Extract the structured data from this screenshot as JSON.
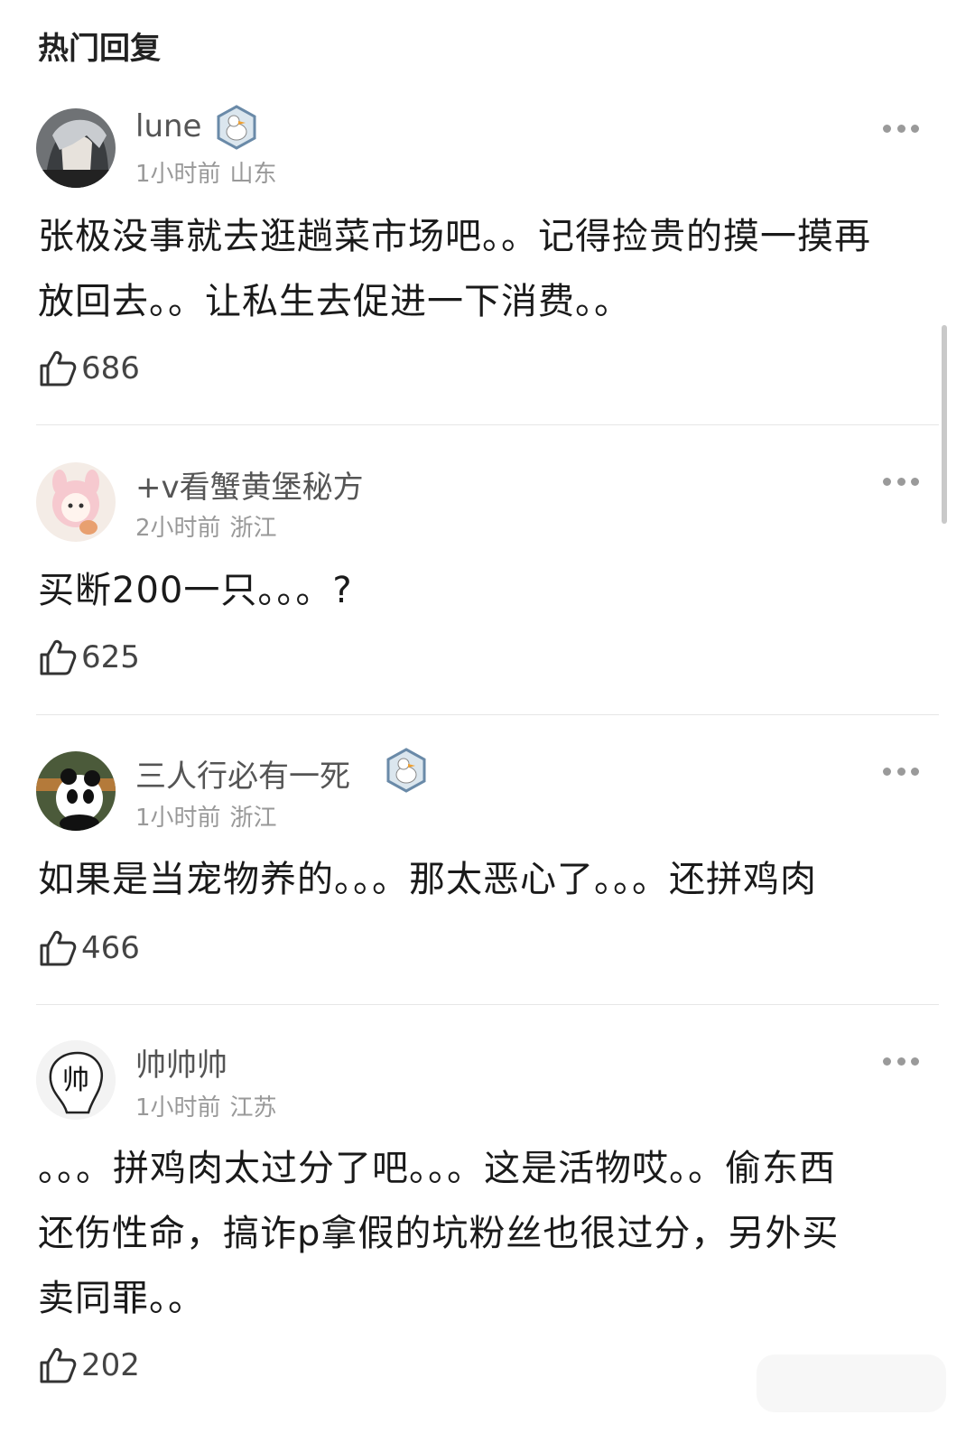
{
  "section_title": "热门回复",
  "comments": [
    {
      "username": "lune",
      "time": "1小时前",
      "location": "山东",
      "has_badge": true,
      "content_lines": [
        "张极没事就去逛趟菜市场吧。。记得捡贵的摸一摸再",
        "放回去。。让私生去促进一下消费。。"
      ],
      "likes": "686"
    },
    {
      "username": "+v看蟹黄堡秘方",
      "time": "2小时前",
      "location": "浙江",
      "has_badge": false,
      "content_lines": [
        "买断200一只。。。?"
      ],
      "likes": "625"
    },
    {
      "username": "三人行必有一死",
      "time": "1小时前",
      "location": "浙江",
      "has_badge": true,
      "content_lines": [
        "如果是当宠物养的。。。那太恶心了。。。还拼鸡肉"
      ],
      "likes": "466"
    },
    {
      "username": "帅帅帅",
      "time": "1小时前",
      "location": "江苏",
      "has_badge": false,
      "avatar_text": "帅",
      "content_lines": [
        "。。。拼鸡肉太过分了吧。。。这是活物哎。。偷东西",
        "还伤性命，搞诈p拿假的坑粉丝也很过分，另外买",
        "卖同罪。。"
      ],
      "likes": "202"
    }
  ],
  "icons": {
    "like": "thumbs-up-icon",
    "more": "more-dots-icon",
    "badge": "duck-badge-icon"
  },
  "colors": {
    "username": "#555555",
    "meta": "#999999",
    "content": "#1a1a1a",
    "divider": "#e6e6e6"
  }
}
